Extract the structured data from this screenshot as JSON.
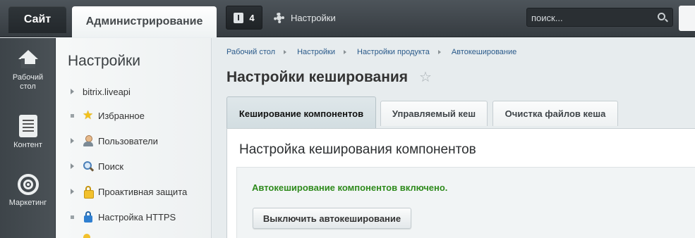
{
  "topbar": {
    "site_tab": "Сайт",
    "admin_tab": "Администрирование",
    "notifications_count": "4",
    "settings_label": "Настройки",
    "search_placeholder": "поиск..."
  },
  "iconbar": {
    "items": [
      {
        "label_line1": "Рабочий",
        "label_line2": "стол",
        "icon": "home-icon"
      },
      {
        "label": "Контент",
        "icon": "content-icon"
      },
      {
        "label": "Маркетинг",
        "icon": "target-icon"
      }
    ]
  },
  "menu": {
    "title": "Настройки",
    "items": [
      {
        "label": "bitrix.liveapi",
        "marker": "arrow",
        "icon": ""
      },
      {
        "label": "Избранное",
        "marker": "bullet",
        "icon": "star-icon"
      },
      {
        "label": "Пользователи",
        "marker": "arrow",
        "icon": "user-icon"
      },
      {
        "label": "Поиск",
        "marker": "arrow",
        "icon": "magnifier-icon"
      },
      {
        "label": "Проактивная защита",
        "marker": "arrow",
        "icon": "lock-icon"
      },
      {
        "label": "Настройка HTTPS",
        "marker": "bullet",
        "icon": "https-lock-icon"
      }
    ]
  },
  "breadcrumb": [
    "Рабочий стол",
    "Настройки",
    "Настройки продукта",
    "Автокеширование"
  ],
  "page": {
    "title": "Настройки кеширования",
    "tabs": [
      {
        "label": "Кеширование компонентов",
        "active": true
      },
      {
        "label": "Управляемый кеш",
        "active": false
      },
      {
        "label": "Очистка файлов кеша",
        "active": false
      }
    ],
    "section_title": "Настройка кеширования компонентов",
    "status_message": "Автокеширование компонентов включено.",
    "button_label": "Выключить автокеширование"
  },
  "colors": {
    "topbar": "#3f464b",
    "status_green": "#2e8a1c",
    "link_blue": "#2a5a8a"
  }
}
